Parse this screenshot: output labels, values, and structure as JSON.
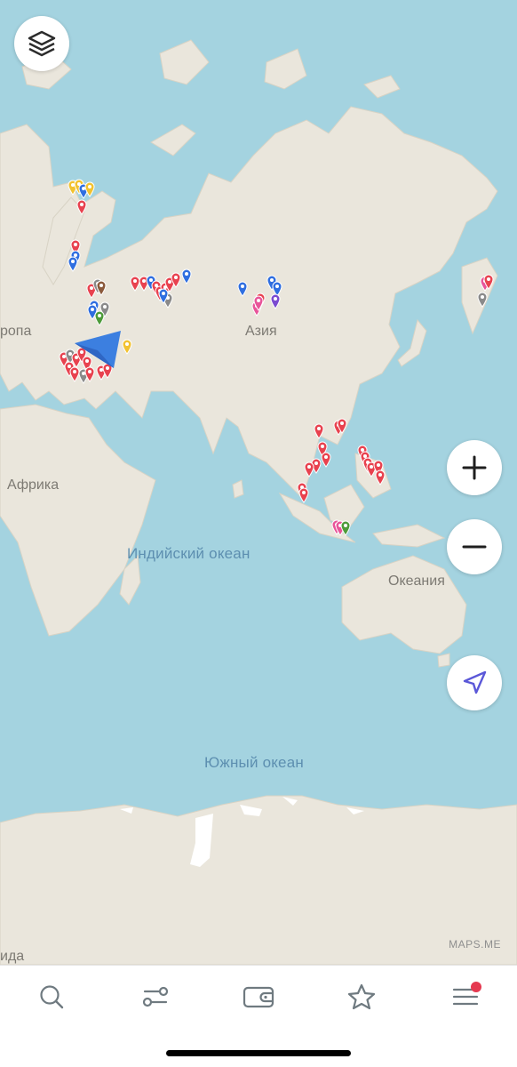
{
  "map": {
    "labels": {
      "europe": "ропа",
      "asia": "Азия",
      "africa": "Африка",
      "oceania": "Океания",
      "antarctica": "ида"
    },
    "oceans": {
      "indian": "Индийский океан",
      "southern": "Южный океан"
    },
    "attribution": "MAPS.ME",
    "pin_colors": {
      "red": "#e8424f",
      "blue": "#2f6ee0",
      "yellow": "#f2c230",
      "gray": "#8a8a8a",
      "brown": "#8b5a3c",
      "pink": "#e8559a",
      "purple": "#7b4bd0",
      "green": "#4d9b3a",
      "teal": "#3b9f9b"
    },
    "location_arrow_color": "#3c7fe0"
  },
  "controls": {
    "layers": "layers-icon",
    "zoom_in": "plus-icon",
    "zoom_out": "minus-icon",
    "my_position": "navigation-arrow-icon"
  },
  "bottom_nav": {
    "items": [
      "search-icon",
      "route-icon",
      "wallet-icon",
      "star-icon",
      "menu-icon"
    ],
    "menu_badge_color": "#e53950"
  }
}
